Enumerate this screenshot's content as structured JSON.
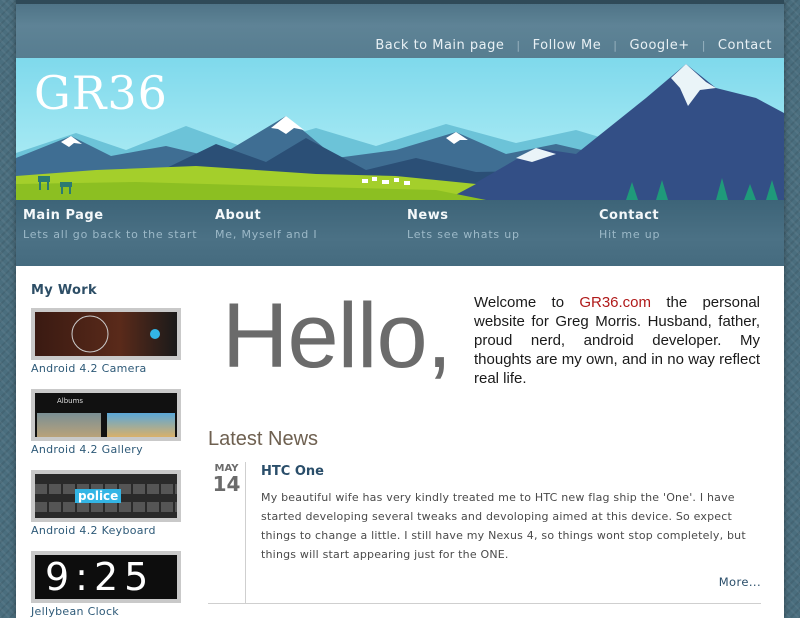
{
  "topnav": {
    "items": [
      "Back to Main page",
      "Follow Me",
      "Google+",
      "Contact"
    ],
    "separator": "|"
  },
  "banner": {
    "logo": "GR36"
  },
  "menu": {
    "items": [
      {
        "title": "Main Page",
        "subtitle": "Lets all go back to the start"
      },
      {
        "title": "About",
        "subtitle": "Me, Myself and I"
      },
      {
        "title": "News",
        "subtitle": "Lets see whats up"
      },
      {
        "title": "Contact",
        "subtitle": "Hit me up"
      }
    ]
  },
  "sidebar": {
    "heading": "My Work",
    "items": [
      {
        "caption": "Android 4.2 Camera"
      },
      {
        "caption": "Android 4.2 Gallery",
        "thumb_text": "Albums"
      },
      {
        "caption": "Android 4.2 Keyboard",
        "thumb_text": "police"
      },
      {
        "caption": "Jellybean Clock",
        "thumb_text": "9:25"
      }
    ]
  },
  "main": {
    "hello": "Hello,",
    "welcome_pre": "Welcome to ",
    "welcome_site": "GR36.com",
    "welcome_post": " the personal website for Greg Morris. Husband, father, proud nerd, android developer. My thoughts are my own, and in no way reflect real life.",
    "latest_heading": "Latest News",
    "post": {
      "month": "MAY",
      "day": "14",
      "title": "HTC One",
      "body": "My beautiful wife has very kindly treated me to HTC new flag ship the 'One'. I have started developing several tweaks and devoloping aimed at this device. So expect things to change a little. I still have my Nexus 4, so things wont stop completely, but things will start appearing just for the ONE.",
      "more": "More..."
    }
  },
  "colors": {
    "accent_link": "#2a4e6a",
    "site_red": "#b01a1a",
    "header_blue": "#4b7185"
  }
}
